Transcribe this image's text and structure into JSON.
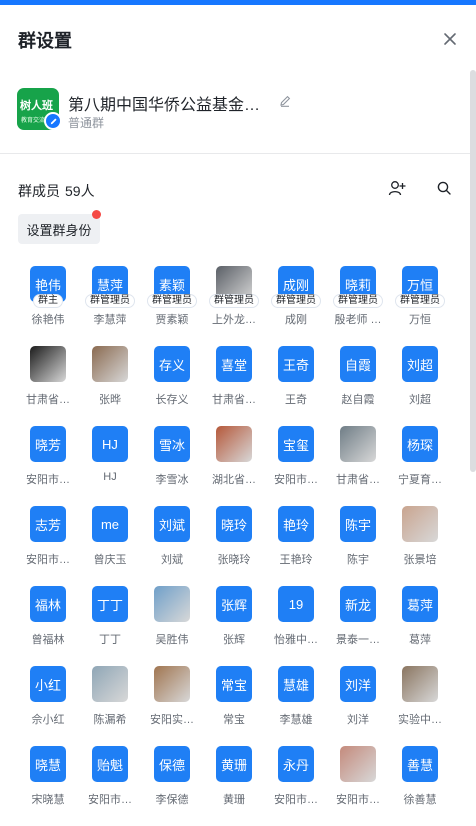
{
  "header": {
    "title": "群设置"
  },
  "group": {
    "avatar_text": "树人班",
    "avatar_subtext": "教育交流",
    "name": "第八期中国华侨公益基金…",
    "type": "普通群"
  },
  "members": {
    "label": "群成员",
    "count": "59人",
    "set_identity_label": "设置群身份",
    "list": [
      {
        "avatar": "艳伟",
        "name": "徐艳伟",
        "badge": "群主",
        "photo": false
      },
      {
        "avatar": "慧萍",
        "name": "李慧萍",
        "badge": "群管理员",
        "photo": false
      },
      {
        "avatar": "素颖",
        "name": "贾素颖",
        "badge": "群管理员",
        "photo": false
      },
      {
        "avatar": "",
        "name": "上外龙…",
        "badge": "群管理员",
        "photo": true,
        "tone": "#5a5f66"
      },
      {
        "avatar": "成刚",
        "name": "成刚",
        "badge": "群管理员",
        "photo": false
      },
      {
        "avatar": "晓莉",
        "name": "殷老师 …",
        "badge": "群管理员",
        "photo": false
      },
      {
        "avatar": "万恒",
        "name": "万恒",
        "badge": "群管理员",
        "photo": false
      },
      {
        "avatar": "",
        "name": "甘肃省…",
        "photo": true,
        "tone": "#1b1b1b"
      },
      {
        "avatar": "",
        "name": "张晔",
        "photo": true,
        "tone": "#8a6a50"
      },
      {
        "avatar": "存义",
        "name": "长存义",
        "photo": false
      },
      {
        "avatar": "喜堂",
        "name": "甘肃省…",
        "photo": false
      },
      {
        "avatar": "王奇",
        "name": "王奇",
        "photo": false
      },
      {
        "avatar": "自霞",
        "name": "赵自霞",
        "photo": false
      },
      {
        "avatar": "刘超",
        "name": "刘超",
        "photo": false
      },
      {
        "avatar": "晓芳",
        "name": "安阳市…",
        "photo": false
      },
      {
        "avatar": "HJ",
        "name": "HJ",
        "photo": false
      },
      {
        "avatar": "雪冰",
        "name": "李雪冰",
        "photo": false
      },
      {
        "avatar": "",
        "name": "湖北省…",
        "photo": true,
        "tone": "#b5583a"
      },
      {
        "avatar": "宝玺",
        "name": "安阳市…",
        "photo": false
      },
      {
        "avatar": "",
        "name": "甘肃省…",
        "photo": true,
        "tone": "#6f7d86"
      },
      {
        "avatar": "杨琛",
        "name": "宁夏育…",
        "photo": false
      },
      {
        "avatar": "志芳",
        "name": "安阳市…",
        "photo": false
      },
      {
        "avatar": "me",
        "name": "曾庆玉",
        "photo": false
      },
      {
        "avatar": "刘斌",
        "name": "刘斌",
        "photo": false
      },
      {
        "avatar": "晓玲",
        "name": "张晓玲",
        "photo": false
      },
      {
        "avatar": "艳玲",
        "name": "王艳玲",
        "photo": false
      },
      {
        "avatar": "陈宇",
        "name": "陈宇",
        "photo": false
      },
      {
        "avatar": "",
        "name": "张景培",
        "photo": true,
        "tone": "#c9a48f"
      },
      {
        "avatar": "福林",
        "name": "曾福林",
        "photo": false
      },
      {
        "avatar": "丁丁",
        "name": "丁丁",
        "photo": false
      },
      {
        "avatar": "",
        "name": "吴胜伟",
        "photo": true,
        "tone": "#6f9fc9"
      },
      {
        "avatar": "张辉",
        "name": "张辉",
        "photo": false
      },
      {
        "avatar": "19",
        "name": "怡雅中…",
        "photo": false
      },
      {
        "avatar": "新龙",
        "name": "景泰一…",
        "photo": false
      },
      {
        "avatar": "葛萍",
        "name": "葛萍",
        "photo": false
      },
      {
        "avatar": "小红",
        "name": "佘小红",
        "photo": false
      },
      {
        "avatar": "",
        "name": "陈漏希",
        "photo": true,
        "tone": "#8fa6b6"
      },
      {
        "avatar": "",
        "name": "安阳实…",
        "photo": true,
        "tone": "#a07550"
      },
      {
        "avatar": "常宝",
        "name": "常宝",
        "photo": false
      },
      {
        "avatar": "慧雄",
        "name": "李慧雄",
        "photo": false
      },
      {
        "avatar": "刘洋",
        "name": "刘洋",
        "photo": false
      },
      {
        "avatar": "",
        "name": "实验中…",
        "photo": true,
        "tone": "#8a7560"
      },
      {
        "avatar": "晓慧",
        "name": "宋晓慧",
        "photo": false
      },
      {
        "avatar": "贻魁",
        "name": "安阳市…",
        "photo": false
      },
      {
        "avatar": "保德",
        "name": "李保德",
        "photo": false
      },
      {
        "avatar": "黄珊",
        "name": "黄珊",
        "photo": false
      },
      {
        "avatar": "永丹",
        "name": "安阳市…",
        "photo": false
      },
      {
        "avatar": "",
        "name": "安阳市…",
        "photo": true,
        "tone": "#c48a7c"
      },
      {
        "avatar": "善慧",
        "name": "徐善慧",
        "photo": false
      }
    ]
  },
  "colors": {
    "accent": "#1677ff",
    "avatar_blue": "#1f7ff5",
    "group_avatar": "#17a34a",
    "notice_dot": "#f54a45"
  },
  "icons": {
    "close": "close-icon",
    "edit": "pencil-icon",
    "add_member": "add-member-icon",
    "search": "search-icon"
  }
}
